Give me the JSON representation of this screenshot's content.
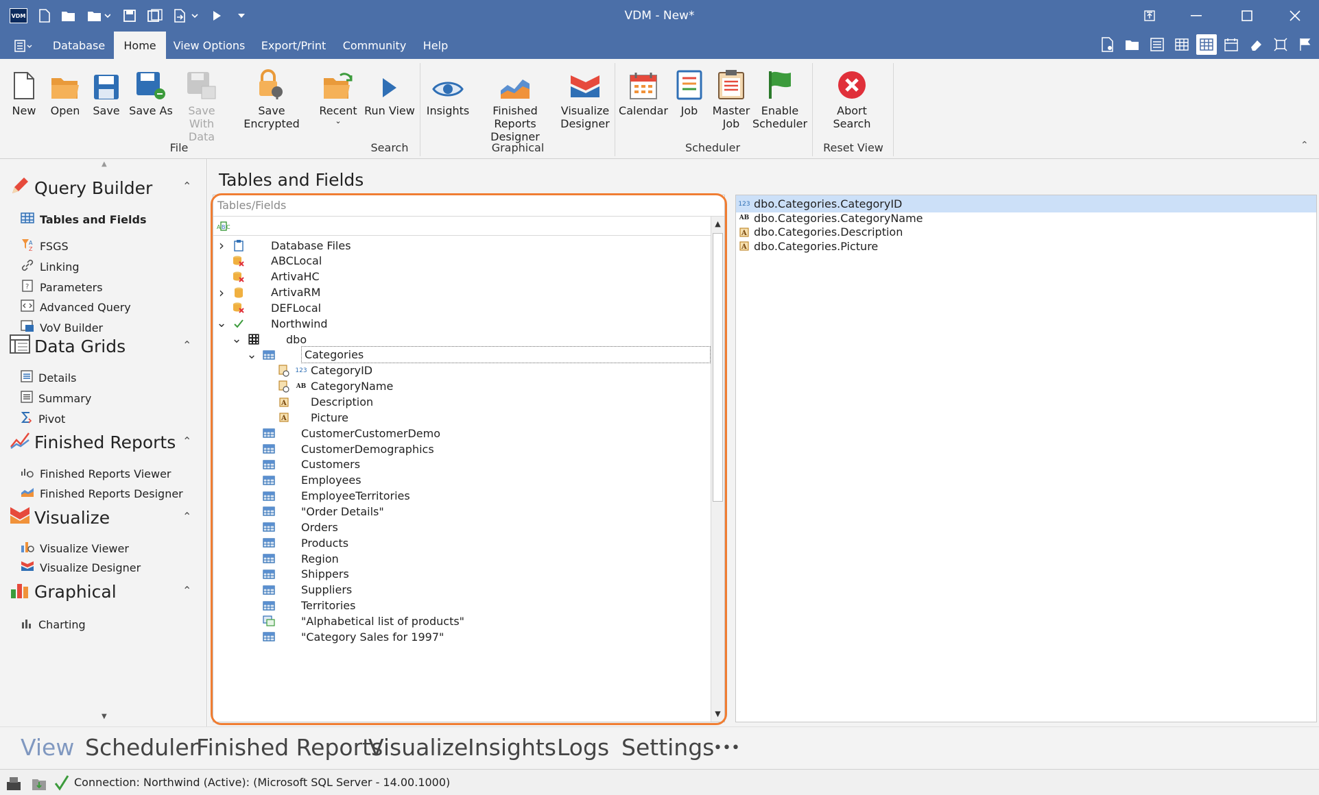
{
  "window": {
    "title": "VDM - New*",
    "logo": "VDM"
  },
  "menu": {
    "tabs": [
      {
        "label": "Database"
      },
      {
        "label": "Home"
      },
      {
        "label": "View Options"
      },
      {
        "label": "Export/Print"
      },
      {
        "label": "Community"
      },
      {
        "label": "Help"
      }
    ],
    "active": "Home"
  },
  "ribbon": {
    "buttons": {
      "new": "New",
      "open": "Open",
      "save": "Save",
      "save_as": "Save As",
      "save_with_data_1": "Save With",
      "save_with_data_2": "Data",
      "save_encrypted": "Save Encrypted",
      "recent": "Recent",
      "run_view": "Run View",
      "insights": "Insights",
      "frd_1": "Finished Reports",
      "frd_2": "Designer",
      "vd_1": "Visualize",
      "vd_2": "Designer",
      "calendar": "Calendar",
      "job": "Job",
      "master_job_1": "Master",
      "master_job_2": "Job",
      "enable_sched_1": "Enable",
      "enable_sched_2": "Scheduler",
      "abort_search_1": "Abort",
      "abort_search_2": "Search"
    },
    "groups": {
      "file": "File",
      "search": "Search",
      "graphical": "Graphical",
      "scheduler": "Scheduler",
      "reset_view": "Reset View"
    }
  },
  "leftnav": {
    "sections": [
      {
        "title": "Query Builder",
        "items": [
          "Tables and Fields",
          "FSGS",
          "Linking",
          "Parameters",
          "Advanced Query",
          "VoV Builder"
        ]
      },
      {
        "title": "Data Grids",
        "items": [
          "Details",
          "Summary",
          "Pivot"
        ]
      },
      {
        "title": "Finished Reports",
        "items": [
          "Finished Reports Viewer",
          "Finished Reports Designer"
        ]
      },
      {
        "title": "Visualize",
        "items": [
          "Visualize Viewer",
          "Visualize Designer"
        ]
      },
      {
        "title": "Graphical",
        "items": [
          "Charting"
        ]
      }
    ]
  },
  "main": {
    "title": "Tables and Fields",
    "tree_header": "Tables/Fields",
    "tree": [
      {
        "label": "Database Files",
        "level": 0,
        "expander": "collapsed",
        "icon": "db-files-icon"
      },
      {
        "label": "ABCLocal",
        "level": 0,
        "expander": "none",
        "icon": "db-error-icon"
      },
      {
        "label": "ArtivaHC",
        "level": 0,
        "expander": "none",
        "icon": "db-error-icon"
      },
      {
        "label": "ArtivaRM",
        "level": 0,
        "expander": "collapsed",
        "icon": "db-icon"
      },
      {
        "label": "DEFLocal",
        "level": 0,
        "expander": "none",
        "icon": "db-error-icon"
      },
      {
        "label": "Northwind",
        "level": 0,
        "expander": "expanded",
        "icon": "check-icon"
      },
      {
        "label": "dbo",
        "level": 1,
        "expander": "expanded",
        "icon": "schema-icon"
      },
      {
        "label": "Categories",
        "level": 2,
        "expander": "expanded",
        "icon": "table-icon",
        "selected": true
      },
      {
        "label": "CategoryID",
        "level": 3,
        "expander": "none",
        "icon": "key-field-icon",
        "type": "123"
      },
      {
        "label": "CategoryName",
        "level": 3,
        "expander": "none",
        "icon": "key-field-icon",
        "type": "AB"
      },
      {
        "label": "Description",
        "level": 3,
        "expander": "none",
        "icon": "memo-field-icon",
        "type": ""
      },
      {
        "label": "Picture",
        "level": 3,
        "expander": "none",
        "icon": "memo-field-icon",
        "type": ""
      },
      {
        "label": "CustomerCustomerDemo",
        "level": 2,
        "expander": "none",
        "icon": "table-icon"
      },
      {
        "label": "CustomerDemographics",
        "level": 2,
        "expander": "none",
        "icon": "table-icon"
      },
      {
        "label": "Customers",
        "level": 2,
        "expander": "none",
        "icon": "table-icon"
      },
      {
        "label": "Employees",
        "level": 2,
        "expander": "none",
        "icon": "table-icon"
      },
      {
        "label": "EmployeeTerritories",
        "level": 2,
        "expander": "none",
        "icon": "table-icon"
      },
      {
        "label": "\"Order Details\"",
        "level": 2,
        "expander": "none",
        "icon": "table-icon"
      },
      {
        "label": "Orders",
        "level": 2,
        "expander": "none",
        "icon": "table-icon"
      },
      {
        "label": "Products",
        "level": 2,
        "expander": "none",
        "icon": "table-icon"
      },
      {
        "label": "Region",
        "level": 2,
        "expander": "none",
        "icon": "table-icon"
      },
      {
        "label": "Shippers",
        "level": 2,
        "expander": "none",
        "icon": "table-icon"
      },
      {
        "label": "Suppliers",
        "level": 2,
        "expander": "none",
        "icon": "table-icon"
      },
      {
        "label": "Territories",
        "level": 2,
        "expander": "none",
        "icon": "table-icon"
      },
      {
        "label": "\"Alphabetical list of products\"",
        "level": 2,
        "expander": "none",
        "icon": "view-icon"
      },
      {
        "label": "\"Category Sales for 1997\"",
        "level": 2,
        "expander": "none",
        "icon": "table-icon"
      }
    ],
    "fields": [
      {
        "label": "dbo.Categories.CategoryID",
        "type": "123",
        "selected": true
      },
      {
        "label": "dbo.Categories.CategoryName",
        "type": "AB"
      },
      {
        "label": "dbo.Categories.Description",
        "type": "A"
      },
      {
        "label": "dbo.Categories.Picture",
        "type": "A"
      }
    ]
  },
  "bottom_tabs": {
    "items": [
      "View",
      "Scheduler",
      "Finished Reports",
      "Visualize",
      "Insights",
      "Logs",
      "Settings",
      "•••"
    ],
    "active": "View"
  },
  "status": {
    "text": "Connection: Northwind (Active): (Microsoft SQL Server - 14.00.1000)"
  },
  "colors": {
    "titlebar": "#4b6fa8",
    "highlight_border": "#f07d32",
    "selection": "#cce0f8",
    "active_bottom_tab": "#8098c0"
  }
}
